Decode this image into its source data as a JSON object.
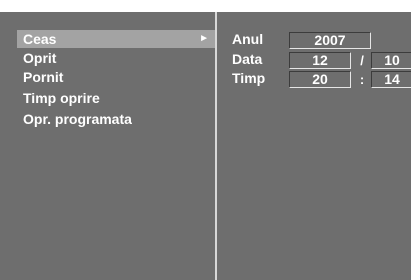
{
  "menu": {
    "items": [
      {
        "label": "Ceas",
        "selected": true
      },
      {
        "label": "Oprit",
        "selected": false
      },
      {
        "label": "Pornit",
        "selected": false
      },
      {
        "label": "Timp oprire",
        "selected": false
      },
      {
        "label": "Opr. programata",
        "selected": false
      }
    ],
    "selected_arrow": "►"
  },
  "clock": {
    "year": {
      "label": "Anul",
      "value": "2007"
    },
    "date": {
      "label": "Data",
      "day": "12",
      "separator": "/",
      "month": "10"
    },
    "time": {
      "label": "Timp",
      "hour": "20",
      "separator": ":",
      "minute": "14"
    }
  },
  "colors": {
    "background": "#6e6e6e",
    "selected_highlight": "#a3a3a3",
    "divider": "#d8d8d8",
    "text": "#ffffff"
  }
}
